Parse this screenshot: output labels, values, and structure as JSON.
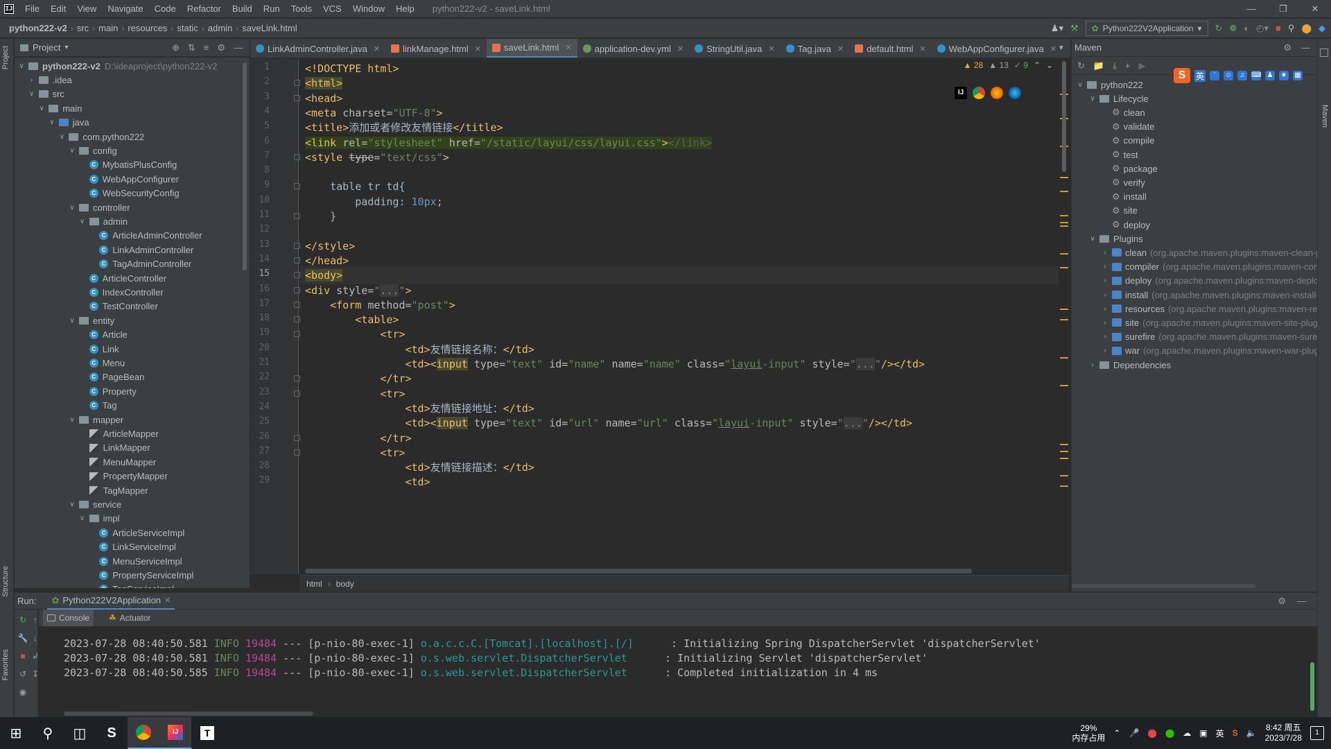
{
  "menubar": {
    "items": [
      "File",
      "Edit",
      "View",
      "Navigate",
      "Code",
      "Refactor",
      "Build",
      "Run",
      "Tools",
      "VCS",
      "Window",
      "Help"
    ],
    "window_title": "python222-v2 - saveLink.html"
  },
  "navbar": {
    "crumbs": [
      "python222-v2",
      "src",
      "main",
      "resources",
      "static",
      "admin",
      "saveLink.html"
    ],
    "run_config": "Python222V2Application"
  },
  "project": {
    "title": "Project",
    "root": "python222-v2",
    "root_path": "D:\\ideaproject\\python222-v2",
    "tree": [
      {
        "label": ".idea",
        "type": "folder",
        "indent": 1,
        "arrow": ">"
      },
      {
        "label": "src",
        "type": "folder",
        "indent": 1,
        "arrow": "v"
      },
      {
        "label": "main",
        "type": "folder",
        "indent": 2,
        "arrow": "v"
      },
      {
        "label": "java",
        "type": "src",
        "indent": 3,
        "arrow": "v"
      },
      {
        "label": "com.python222",
        "type": "folder",
        "indent": 4,
        "arrow": "v"
      },
      {
        "label": "config",
        "type": "folder",
        "indent": 5,
        "arrow": "v"
      },
      {
        "label": "MybatisPlusConfig",
        "type": "class",
        "indent": 6,
        "arrow": ""
      },
      {
        "label": "WebAppConfigurer",
        "type": "class",
        "indent": 6,
        "arrow": ""
      },
      {
        "label": "WebSecurityConfig",
        "type": "class",
        "indent": 6,
        "arrow": ""
      },
      {
        "label": "controller",
        "type": "folder",
        "indent": 5,
        "arrow": "v"
      },
      {
        "label": "admin",
        "type": "folder",
        "indent": 6,
        "arrow": "v"
      },
      {
        "label": "ArticleAdminController",
        "type": "class",
        "indent": 7,
        "arrow": ""
      },
      {
        "label": "LinkAdminController",
        "type": "class",
        "indent": 7,
        "arrow": ""
      },
      {
        "label": "TagAdminController",
        "type": "class",
        "indent": 7,
        "arrow": ""
      },
      {
        "label": "ArticleController",
        "type": "class",
        "indent": 6,
        "arrow": ""
      },
      {
        "label": "IndexController",
        "type": "class",
        "indent": 6,
        "arrow": ""
      },
      {
        "label": "TestController",
        "type": "class",
        "indent": 6,
        "arrow": ""
      },
      {
        "label": "entity",
        "type": "folder",
        "indent": 5,
        "arrow": "v"
      },
      {
        "label": "Article",
        "type": "class",
        "indent": 6,
        "arrow": ""
      },
      {
        "label": "Link",
        "type": "class",
        "indent": 6,
        "arrow": ""
      },
      {
        "label": "Menu",
        "type": "class",
        "indent": 6,
        "arrow": ""
      },
      {
        "label": "PageBean",
        "type": "class",
        "indent": 6,
        "arrow": ""
      },
      {
        "label": "Property",
        "type": "class",
        "indent": 6,
        "arrow": ""
      },
      {
        "label": "Tag",
        "type": "class",
        "indent": 6,
        "arrow": ""
      },
      {
        "label": "mapper",
        "type": "folder",
        "indent": 5,
        "arrow": "v"
      },
      {
        "label": "ArticleMapper",
        "type": "mapper",
        "indent": 6,
        "arrow": ""
      },
      {
        "label": "LinkMapper",
        "type": "mapper",
        "indent": 6,
        "arrow": ""
      },
      {
        "label": "MenuMapper",
        "type": "mapper",
        "indent": 6,
        "arrow": ""
      },
      {
        "label": "PropertyMapper",
        "type": "mapper",
        "indent": 6,
        "arrow": ""
      },
      {
        "label": "TagMapper",
        "type": "mapper",
        "indent": 6,
        "arrow": ""
      },
      {
        "label": "service",
        "type": "folder",
        "indent": 5,
        "arrow": "v"
      },
      {
        "label": "impl",
        "type": "folder",
        "indent": 6,
        "arrow": "v"
      },
      {
        "label": "ArticleServiceImpl",
        "type": "class",
        "indent": 7,
        "arrow": ""
      },
      {
        "label": "LinkServiceImpl",
        "type": "class",
        "indent": 7,
        "arrow": ""
      },
      {
        "label": "MenuServiceImpl",
        "type": "class",
        "indent": 7,
        "arrow": ""
      },
      {
        "label": "PropertyServiceImpl",
        "type": "class",
        "indent": 7,
        "arrow": ""
      },
      {
        "label": "TagServiceImpl",
        "type": "class",
        "indent": 7,
        "arrow": ""
      }
    ]
  },
  "tabs": [
    {
      "label": "LinkAdminController.java",
      "kind": "java",
      "active": false
    },
    {
      "label": "linkManage.html",
      "kind": "html",
      "active": false
    },
    {
      "label": "saveLink.html",
      "kind": "html",
      "active": true
    },
    {
      "label": "application-dev.yml",
      "kind": "yml",
      "active": false
    },
    {
      "label": "StringUtil.java",
      "kind": "java",
      "active": false
    },
    {
      "label": "Tag.java",
      "kind": "java",
      "active": false
    },
    {
      "label": "default.html",
      "kind": "html",
      "active": false
    },
    {
      "label": "WebAppConfigurer.java",
      "kind": "java",
      "active": false
    }
  ],
  "inspections": {
    "warnings": "28",
    "weak": "13",
    "ok": "9"
  },
  "editor": {
    "current_line": 15,
    "lines": [
      [
        [
          "tag",
          "<!DOCTYPE html>"
        ]
      ],
      [
        [
          "tag hl",
          "<html>"
        ]
      ],
      [
        [
          "tag",
          "<head>"
        ]
      ],
      [
        [
          "tag",
          "<meta "
        ],
        [
          "attr",
          "charset="
        ],
        [
          "str",
          "\"UTF-8\""
        ],
        [
          "tag",
          ">"
        ]
      ],
      [
        [
          "tag",
          "<title>"
        ],
        [
          "",
          "添加或者修改友情链接"
        ],
        [
          "tag",
          "</title>"
        ]
      ],
      [
        [
          "tag hlbox",
          "<link "
        ],
        [
          "attr hlbox",
          "rel="
        ],
        [
          "str hlbox",
          "\"stylesheet\" "
        ],
        [
          "attr hlbox",
          "href="
        ],
        [
          "str hlbox",
          "\"/static/layui/css/layui.css\""
        ],
        [
          "tag hlbox",
          ">"
        ],
        [
          "dim hlbox",
          "</link>"
        ]
      ],
      [
        [
          "tag",
          "<style "
        ],
        [
          "strike",
          "type"
        ],
        [
          "attr",
          "="
        ],
        [
          "str",
          "\"text/css\""
        ],
        [
          "tag",
          ">"
        ]
      ],
      [
        [
          "",
          ""
        ]
      ],
      [
        [
          "",
          "    table tr td{"
        ]
      ],
      [
        [
          "",
          "        padding: "
        ],
        [
          "num",
          "10px"
        ],
        [
          "",
          ";"
        ]
      ],
      [
        [
          "",
          "    }"
        ]
      ],
      [
        [
          "",
          ""
        ]
      ],
      [
        [
          "tag",
          "</style>"
        ]
      ],
      [
        [
          "tag",
          "</head>"
        ]
      ],
      [
        [
          "tag hl",
          "<body>"
        ]
      ],
      [
        [
          "tag",
          "<div "
        ],
        [
          "attr",
          "style="
        ],
        [
          "str",
          "\""
        ],
        [
          "fold",
          "..."
        ],
        [
          "str",
          "\""
        ],
        [
          "tag",
          ">"
        ]
      ],
      [
        [
          "tag",
          "    <form "
        ],
        [
          "attr",
          "method="
        ],
        [
          "str",
          "\"post\""
        ],
        [
          "tag",
          ">"
        ]
      ],
      [
        [
          "tag",
          "        <table>"
        ]
      ],
      [
        [
          "tag",
          "            <tr>"
        ]
      ],
      [
        [
          "tag",
          "                <td>"
        ],
        [
          "",
          "友情链接名称："
        ],
        [
          "tag",
          "</td>"
        ]
      ],
      [
        [
          "tag",
          "                <td><"
        ],
        [
          "tag hl",
          "input"
        ],
        [
          "attr",
          " type="
        ],
        [
          "str",
          "\"text\" "
        ],
        [
          "attr",
          "id="
        ],
        [
          "str",
          "\"name\" "
        ],
        [
          "attr",
          "name="
        ],
        [
          "str",
          "\"name\" "
        ],
        [
          "attr",
          "class="
        ],
        [
          "str",
          "\""
        ],
        [
          "str uline",
          "layui"
        ],
        [
          "str",
          "-input\" "
        ],
        [
          "attr",
          "style="
        ],
        [
          "str",
          "\""
        ],
        [
          "fold",
          "..."
        ],
        [
          "str",
          "\""
        ],
        [
          "tag",
          "/></td>"
        ]
      ],
      [
        [
          "tag",
          "            </tr>"
        ]
      ],
      [
        [
          "tag",
          "            <tr>"
        ]
      ],
      [
        [
          "tag",
          "                <td>"
        ],
        [
          "",
          "友情链接地址："
        ],
        [
          "tag",
          "</td>"
        ]
      ],
      [
        [
          "tag",
          "                <td><"
        ],
        [
          "tag hl",
          "input"
        ],
        [
          "attr",
          " type="
        ],
        [
          "str",
          "\"text\" "
        ],
        [
          "attr",
          "id="
        ],
        [
          "str",
          "\"url\" "
        ],
        [
          "attr",
          "name="
        ],
        [
          "str",
          "\"url\" "
        ],
        [
          "attr",
          "class="
        ],
        [
          "str",
          "\""
        ],
        [
          "str uline",
          "layui"
        ],
        [
          "str",
          "-input\" "
        ],
        [
          "attr",
          "style="
        ],
        [
          "str",
          "\""
        ],
        [
          "fold",
          "..."
        ],
        [
          "str",
          "\""
        ],
        [
          "tag",
          "/></td>"
        ]
      ],
      [
        [
          "tag",
          "            </tr>"
        ]
      ],
      [
        [
          "tag",
          "            <tr>"
        ]
      ],
      [
        [
          "tag",
          "                <td>"
        ],
        [
          "",
          "友情链接描述："
        ],
        [
          "tag",
          "</td>"
        ]
      ],
      [
        [
          "tag",
          "                <td>"
        ]
      ]
    ],
    "breadcrumb": [
      "html",
      "body"
    ]
  },
  "maven": {
    "title": "Maven",
    "root": "python222",
    "lifecycle_label": "Lifecycle",
    "lifecycle": [
      "clean",
      "validate",
      "compile",
      "test",
      "package",
      "verify",
      "install",
      "site",
      "deploy"
    ],
    "plugins_label": "Plugins",
    "plugins": [
      {
        "name": "clean",
        "coord": "(org.apache.maven.plugins:maven-clean-p"
      },
      {
        "name": "compiler",
        "coord": "(org.apache.maven.plugins:maven-con"
      },
      {
        "name": "deploy",
        "coord": "(org.apache.maven.plugins:maven-deplc"
      },
      {
        "name": "install",
        "coord": "(org.apache.maven.plugins:maven-install-"
      },
      {
        "name": "resources",
        "coord": "(org.apache.maven.plugins:maven-re"
      },
      {
        "name": "site",
        "coord": "(org.apache.maven.plugins:maven-site-plug"
      },
      {
        "name": "surefire",
        "coord": "(org.apache.maven.plugins:maven-suref"
      },
      {
        "name": "war",
        "coord": "(org.apache.maven.plugins:maven-war-plug"
      }
    ],
    "dependencies_label": "Dependencies"
  },
  "ime": {
    "lang": "英"
  },
  "run": {
    "label": "Run:",
    "tab": "Python222V2Application",
    "console_tab": "Console",
    "actuator_tab": "Actuator",
    "log": [
      {
        "ts": "2023-07-28 08:40:50.581",
        "level": "INFO",
        "pid": "19484",
        "sep": "---",
        "thread": "[p-nio-80-exec-1]",
        "logger": "o.a.c.c.C.[Tomcat].[localhost].[/]",
        "msg": ": Initializing Spring DispatcherServlet 'dispatcherServlet'"
      },
      {
        "ts": "2023-07-28 08:40:50.581",
        "level": "INFO",
        "pid": "19484",
        "sep": "---",
        "thread": "[p-nio-80-exec-1]",
        "logger": "o.s.web.servlet.DispatcherServlet",
        "msg": ": Initializing Servlet 'dispatcherServlet'"
      },
      {
        "ts": "2023-07-28 08:40:50.585",
        "level": "INFO",
        "pid": "19484",
        "sep": "---",
        "thread": "[p-nio-80-exec-1]",
        "logger": "o.s.web.servlet.DispatcherServlet",
        "msg": ": Completed initialization in 4 ms"
      }
    ]
  },
  "side_tabs": {
    "project": "Project",
    "structure": "Structure",
    "favorites": "Favorites",
    "maven": "Maven"
  },
  "taskbar": {
    "mem_percent": "29%",
    "mem_label": "内存占用",
    "ime": "英",
    "time": "8:42 周五",
    "date": "2023/7/28",
    "notif_count": "1"
  },
  "colors": {
    "accent": "#4a88c7",
    "bg": "#2b2b2b",
    "panel": "#3c3f41"
  }
}
